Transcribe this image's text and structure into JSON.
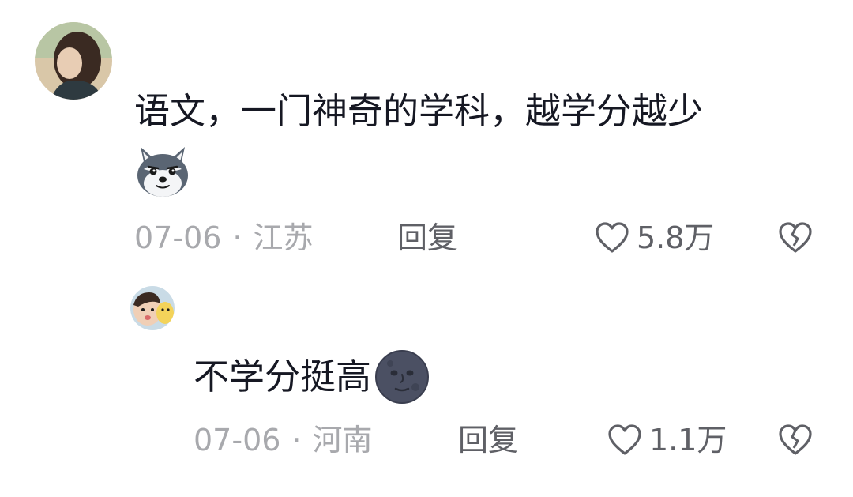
{
  "comments": [
    {
      "text": "语文，一门神奇的学科，越学分越少",
      "emoji": "husky-dog-emoji",
      "date": "07-06",
      "separator": "·",
      "location": "江苏",
      "reply_label": "回复",
      "likes": "5.8万"
    },
    {
      "text": "不学分挺高",
      "emoji": "new-moon-face-emoji",
      "date": "07-06",
      "separator": "·",
      "location": "河南",
      "reply_label": "回复",
      "likes": "1.1万"
    }
  ]
}
